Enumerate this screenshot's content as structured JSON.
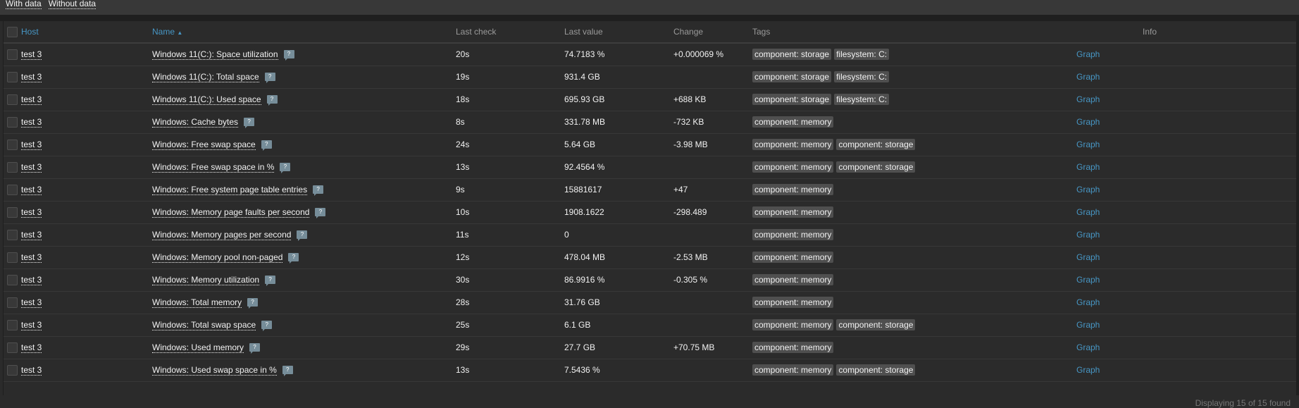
{
  "filter_tabs": [
    "With data",
    "Without data"
  ],
  "columns": {
    "host": "Host",
    "name": "Name",
    "last_check": "Last check",
    "last_value": "Last value",
    "change": "Change",
    "tags": "Tags",
    "info": "Info"
  },
  "rows": [
    {
      "host": "test 3",
      "name": "Windows 11(C:): Space utilization",
      "last_check": "20s",
      "last_value": "74.7183 %",
      "change": "+0.000069 %",
      "tags": [
        "component: storage",
        "filesystem: C:"
      ],
      "graph": "Graph"
    },
    {
      "host": "test 3",
      "name": "Windows 11(C:): Total space",
      "last_check": "19s",
      "last_value": "931.4 GB",
      "change": "",
      "tags": [
        "component: storage",
        "filesystem: C:"
      ],
      "graph": "Graph"
    },
    {
      "host": "test 3",
      "name": "Windows 11(C:): Used space",
      "last_check": "18s",
      "last_value": "695.93 GB",
      "change": "+688 KB",
      "tags": [
        "component: storage",
        "filesystem: C:"
      ],
      "graph": "Graph"
    },
    {
      "host": "test 3",
      "name": "Windows: Cache bytes",
      "last_check": "8s",
      "last_value": "331.78 MB",
      "change": "-732 KB",
      "tags": [
        "component: memory"
      ],
      "graph": "Graph"
    },
    {
      "host": "test 3",
      "name": "Windows: Free swap space",
      "last_check": "24s",
      "last_value": "5.64 GB",
      "change": "-3.98 MB",
      "tags": [
        "component: memory",
        "component: storage"
      ],
      "graph": "Graph"
    },
    {
      "host": "test 3",
      "name": "Windows: Free swap space in %",
      "last_check": "13s",
      "last_value": "92.4564 %",
      "change": "",
      "tags": [
        "component: memory",
        "component: storage"
      ],
      "graph": "Graph"
    },
    {
      "host": "test 3",
      "name": "Windows: Free system page table entries",
      "last_check": "9s",
      "last_value": "15881617",
      "change": "+47",
      "tags": [
        "component: memory"
      ],
      "graph": "Graph"
    },
    {
      "host": "test 3",
      "name": "Windows: Memory page faults per second",
      "last_check": "10s",
      "last_value": "1908.1622",
      "change": "-298.489",
      "tags": [
        "component: memory"
      ],
      "graph": "Graph"
    },
    {
      "host": "test 3",
      "name": "Windows: Memory pages per second",
      "last_check": "11s",
      "last_value": "0",
      "change": "",
      "tags": [
        "component: memory"
      ],
      "graph": "Graph"
    },
    {
      "host": "test 3",
      "name": "Windows: Memory pool non-paged",
      "last_check": "12s",
      "last_value": "478.04 MB",
      "change": "-2.53 MB",
      "tags": [
        "component: memory"
      ],
      "graph": "Graph"
    },
    {
      "host": "test 3",
      "name": "Windows: Memory utilization",
      "last_check": "30s",
      "last_value": "86.9916 %",
      "change": "-0.305 %",
      "tags": [
        "component: memory"
      ],
      "graph": "Graph"
    },
    {
      "host": "test 3",
      "name": "Windows: Total memory",
      "last_check": "28s",
      "last_value": "31.76 GB",
      "change": "",
      "tags": [
        "component: memory"
      ],
      "graph": "Graph"
    },
    {
      "host": "test 3",
      "name": "Windows: Total swap space",
      "last_check": "25s",
      "last_value": "6.1 GB",
      "change": "",
      "tags": [
        "component: memory",
        "component: storage"
      ],
      "graph": "Graph"
    },
    {
      "host": "test 3",
      "name": "Windows: Used memory",
      "last_check": "29s",
      "last_value": "27.7 GB",
      "change": "+70.75 MB",
      "tags": [
        "component: memory"
      ],
      "graph": "Graph"
    },
    {
      "host": "test 3",
      "name": "Windows: Used swap space in %",
      "last_check": "13s",
      "last_value": "7.5436 %",
      "change": "",
      "tags": [
        "component: memory",
        "component: storage"
      ],
      "graph": "Graph"
    }
  ],
  "hint_glyph": "?",
  "sort_arrow": "▲",
  "footer": "Displaying 15 of 15 found",
  "colors": {
    "link": "#4796c4",
    "background": "#2b2b2b",
    "tag_bg": "#4f4f4f"
  }
}
